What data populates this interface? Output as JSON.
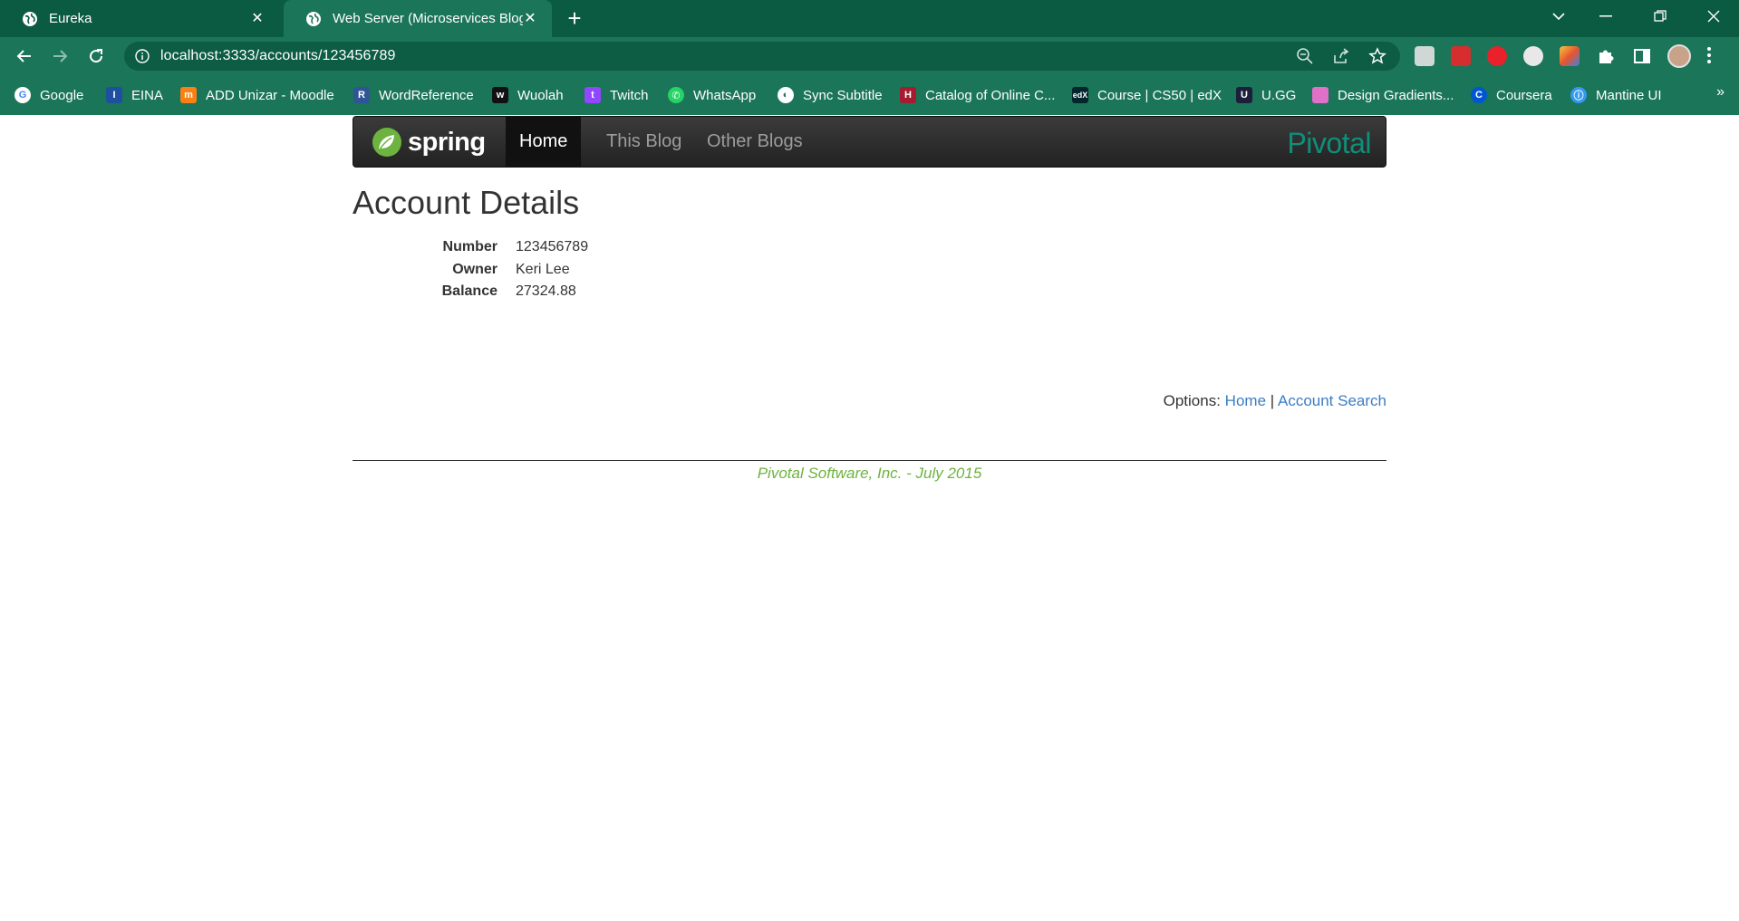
{
  "browser": {
    "tabs": [
      {
        "title": "Eureka"
      },
      {
        "title": "Web Server (Microservices Blog D"
      }
    ],
    "url": "localhost:3333/accounts/123456789",
    "bookmarks": [
      {
        "label": "Google",
        "icon": "google-icon",
        "color": "#ffffff"
      },
      {
        "label": "EINA",
        "icon": "eina-icon",
        "color": "#1e4fa1"
      },
      {
        "label": "ADD Unizar - Moodle",
        "icon": "moodle-icon",
        "color": "#f98012"
      },
      {
        "label": "WordReference",
        "icon": "wordreference-icon",
        "color": "#2f5597"
      },
      {
        "label": "Wuolah",
        "icon": "wuolah-icon",
        "color": "#111111"
      },
      {
        "label": "Twitch",
        "icon": "twitch-icon",
        "color": "#9146ff"
      },
      {
        "label": "WhatsApp",
        "icon": "whatsapp-icon",
        "color": "#25d366"
      },
      {
        "label": "Sync Subtitle",
        "icon": "globe-icon",
        "color": "#ffffff"
      },
      {
        "label": "Catalog of Online C...",
        "icon": "harvard-icon",
        "color": "#a51c30"
      },
      {
        "label": "Course | CS50 | edX",
        "icon": "edx-icon",
        "color": "#02262b"
      },
      {
        "label": "U.GG",
        "icon": "ugg-icon",
        "color": "#1b1f3b"
      },
      {
        "label": "Design Gradients...",
        "icon": "gradients-icon",
        "color": "#e070c8"
      },
      {
        "label": "Coursera",
        "icon": "coursera-icon",
        "color": "#0056d2"
      },
      {
        "label": "Mantine UI",
        "icon": "mantine-icon",
        "color": "#339af0"
      }
    ]
  },
  "site": {
    "brand": "spring",
    "nav": {
      "home": "Home",
      "this_blog": "This Blog",
      "other_blogs": "Other Blogs"
    },
    "logo_right": "Pivotal"
  },
  "account": {
    "title": "Account Details",
    "fields": [
      {
        "label": "Number",
        "value": "123456789"
      },
      {
        "label": "Owner",
        "value": "Keri Lee"
      },
      {
        "label": "Balance",
        "value": "27324.88"
      }
    ]
  },
  "options": {
    "label": "Options:",
    "home": "Home",
    "separator": "|",
    "account_search": "Account Search"
  },
  "footer": "Pivotal Software, Inc. - July 2015",
  "colors": {
    "chrome_dark": "#0b5a42",
    "chrome": "#1b7558",
    "link": "#3b7dc4",
    "footer": "#6db33f",
    "pivotal": "#0f8f79"
  }
}
